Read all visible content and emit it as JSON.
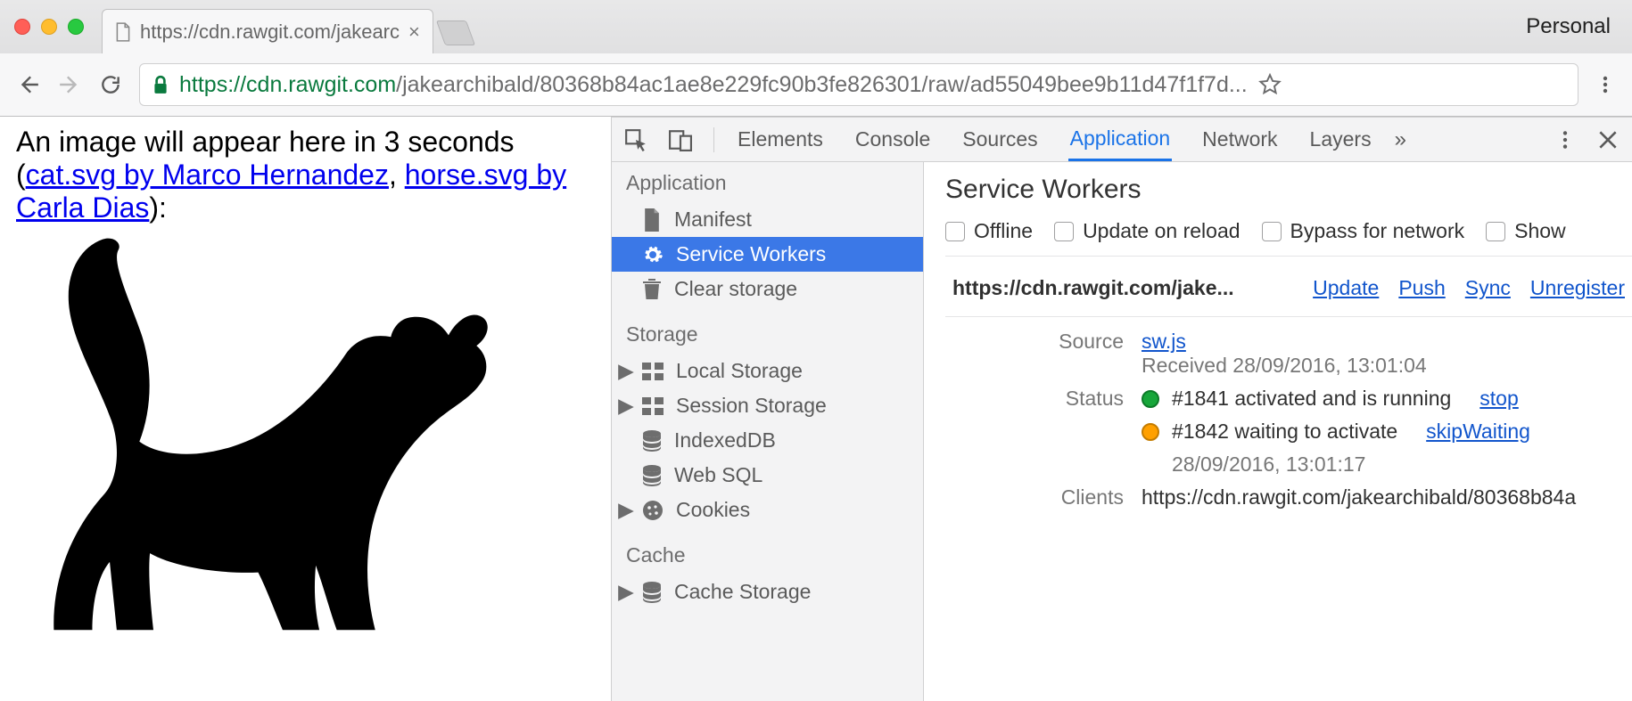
{
  "browser": {
    "profile_label": "Personal",
    "tab_title": "https://cdn.rawgit.com/jakearc",
    "url_scheme": "https",
    "url_host": "://cdn.rawgit.com",
    "url_path": "/jakearchibald/80368b84ac1ae8e229fc90b3fe826301/raw/ad55049bee9b11d47f1f7d..."
  },
  "page": {
    "text_before": "An image will appear here in 3 seconds (",
    "link1": "cat.svg by Marco Hernandez",
    "sep": ", ",
    "link2": "horse.svg by Carla Dias",
    "text_after": "):"
  },
  "devtools": {
    "tabs": [
      "Elements",
      "Console",
      "Sources",
      "Application",
      "Network",
      "Layers"
    ],
    "active_tab": "Application",
    "sidebar": {
      "groups": [
        {
          "title": "Application",
          "items": [
            {
              "label": "Manifest",
              "icon": "doc"
            },
            {
              "label": "Service Workers",
              "icon": "gear",
              "active": true
            },
            {
              "label": "Clear storage",
              "icon": "trash"
            }
          ]
        },
        {
          "title": "Storage",
          "items": [
            {
              "label": "Local Storage",
              "icon": "storage",
              "arrow": true
            },
            {
              "label": "Session Storage",
              "icon": "storage",
              "arrow": true
            },
            {
              "label": "IndexedDB",
              "icon": "db"
            },
            {
              "label": "Web SQL",
              "icon": "db"
            },
            {
              "label": "Cookies",
              "icon": "cookie",
              "arrow": true
            }
          ]
        },
        {
          "title": "Cache",
          "items": [
            {
              "label": "Cache Storage",
              "icon": "db",
              "arrow": true
            }
          ]
        }
      ]
    },
    "panel": {
      "title": "Service Workers",
      "options": [
        "Offline",
        "Update on reload",
        "Bypass for network",
        "Show"
      ],
      "worker_origin": "https://cdn.rawgit.com/jake...",
      "actions": [
        "Update",
        "Push",
        "Sync",
        "Unregister"
      ],
      "source_label": "Source",
      "source_link": "sw.js",
      "source_received": "Received 28/09/2016, 13:01:04",
      "status_label": "Status",
      "status1_text": "#1841 activated and is running",
      "status1_action": "stop",
      "status2_text": "#1842 waiting to activate",
      "status2_action": "skipWaiting",
      "status2_time": "28/09/2016, 13:01:17",
      "clients_label": "Clients",
      "clients_value": "https://cdn.rawgit.com/jakearchibald/80368b84a"
    }
  }
}
